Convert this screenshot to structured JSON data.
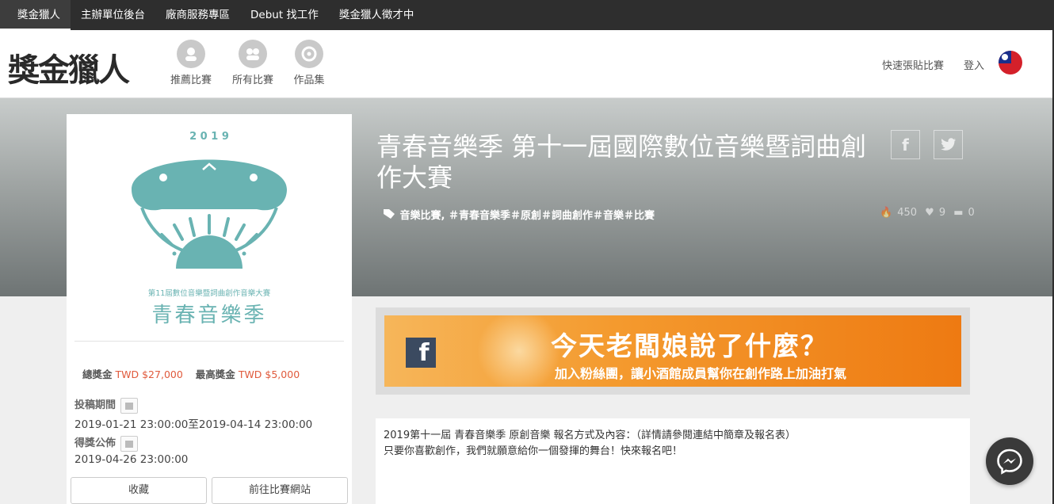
{
  "topnav": {
    "items": [
      "獎金獵人",
      "主辦單位後台",
      "廠商服務專區",
      "Debut 找工作",
      "獎金獵人徵才中"
    ]
  },
  "header": {
    "logo": "獎金獵人",
    "nav": [
      {
        "label": "推薦比賽",
        "icon": "recommend-icon"
      },
      {
        "label": "所有比賽",
        "icon": "all-contests-icon"
      },
      {
        "label": "作品集",
        "icon": "portfolio-icon"
      }
    ],
    "quick_post": "快速張貼比賽",
    "login": "登入"
  },
  "hero": {
    "title": "青春音樂季 第十一屆國際數位音樂暨詞曲創作大賽",
    "tags": "音樂比賽, ＃青春音樂季＃原創＃詞曲創作＃音樂＃比賽",
    "views": "450",
    "likes": "9",
    "comments": "0"
  },
  "poster": {
    "year": "2 0 1 9",
    "subtitle": "第11屆數位音樂暨詞曲創作音樂大賽",
    "title": "青春音樂季",
    "teal": "#69b3b2"
  },
  "prize": {
    "total_label": "總獎金",
    "total_value": "TWD $27,000",
    "max_label": "最高獎金",
    "max_value": "TWD $5,000"
  },
  "schedule": {
    "submit_label": "投稿期間",
    "submit_value": "2019-01-21 23:00:00至2019-04-14 23:00:00",
    "announce_label": "得獎公佈",
    "announce_value": "2019-04-26 23:00:00"
  },
  "buttons": {
    "favorite": "收藏",
    "website": "前往比賽網站"
  },
  "banner": {
    "fb": "f",
    "headline": "今天老闆娘說了什麼？",
    "sub": "加入粉絲團，讓小酒館成員幫你在創作路上加油打氣"
  },
  "description": {
    "line1": "2019第十一屆 青春音樂季 原創音樂 報名方式及內容：（詳情請參閱連結中簡章及報名表）",
    "line2": "只要你喜歡創作，我們就願意給你一個發揮的舞台！快來報名吧！"
  },
  "colors": {
    "topbar": "#2e2e2e",
    "prize": "#e05a3c",
    "banner": "#f49a2e"
  }
}
